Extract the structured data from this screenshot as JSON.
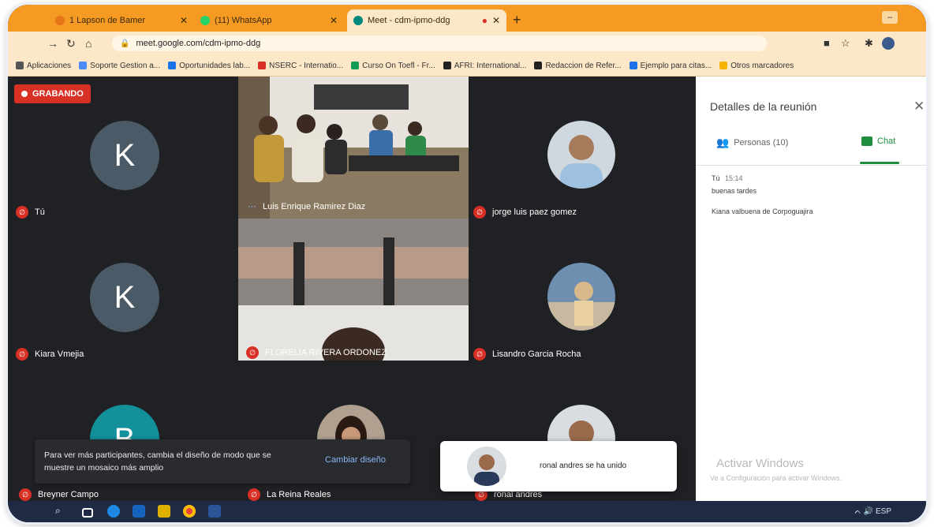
{
  "browser": {
    "tabs": [
      {
        "label": "1 Lapson de Bamer",
        "color": "#e8741a",
        "active": false
      },
      {
        "label": "(11) WhatsApp",
        "color": "#25d366",
        "active": false
      },
      {
        "label": "Meet - cdm-ipmo-ddg",
        "color": "#00897b",
        "active": true
      }
    ],
    "new_tab": "+",
    "minimize": "–",
    "url": "meet.google.com/cdm-ipmo-ddg",
    "bookmarks": [
      {
        "label": "Aplicaciones",
        "color": "#555555"
      },
      {
        "label": "Soporte Gestion a...",
        "color": "#4c8bf5"
      },
      {
        "label": "Oportunidades lab...",
        "color": "#1a73e8"
      },
      {
        "label": "NSERC - Internatio...",
        "color": "#d93025"
      },
      {
        "label": "Curso On Toefl - Fr...",
        "color": "#0f9d58"
      },
      {
        "label": "AFRI: International...",
        "color": "#222222"
      },
      {
        "label": "Redaccion de Refer...",
        "color": "#222222"
      },
      {
        "label": "Ejemplo para citas...",
        "color": "#1a73e8"
      },
      {
        "label": "Otros marcadores",
        "color": "#f4b400"
      }
    ]
  },
  "meet": {
    "recording_label": "GRABANDO",
    "participants": [
      {
        "name": "Tú",
        "initial": "K",
        "kind": "initial"
      },
      {
        "name": "Luis Enrique Ramirez Diaz",
        "kind": "video"
      },
      {
        "name": "jorge luis paez gomez",
        "kind": "photo"
      },
      {
        "name": "Kiara Vmejia",
        "initial": "K",
        "kind": "initial"
      },
      {
        "name": "FLORELIA RIVERA ORDONEZ",
        "kind": "video"
      },
      {
        "name": "Lisandro Garcia Rocha",
        "kind": "photo"
      },
      {
        "name": "Breyner Campo",
        "initial": "B",
        "kind": "initial"
      },
      {
        "name": "La Reina Reales",
        "kind": "photo"
      },
      {
        "name": "ronal andres",
        "kind": "photo"
      }
    ],
    "layout_toast": {
      "message": "Para ver más participantes, cambia el diseño de modo que se muestre un mosaico más amplio",
      "action": "Cambiar diseño"
    },
    "join_toast": {
      "text": "ronal andres se ha unido"
    }
  },
  "panel": {
    "title": "Detalles de la reunión",
    "close": "✕",
    "tab_people": "Personas (10)",
    "tab_chat": "Chat",
    "messages": [
      {
        "sender": "Tú",
        "time": "15:14",
        "text": "buenas tardes"
      },
      {
        "text": "Kiana valbuena de Corpoguajira"
      }
    ],
    "activate_title": "Activar Windows",
    "activate_sub": "Ve a Configuración para activar Windows."
  },
  "taskbar": {
    "tray_text": "ᨈ 🔊 ESP"
  }
}
